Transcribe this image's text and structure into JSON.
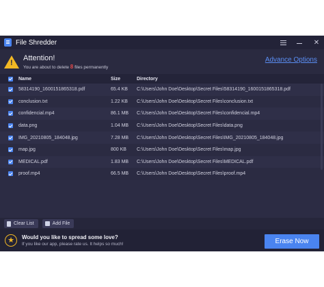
{
  "window": {
    "title": "File Shredder"
  },
  "attention": {
    "title": "Attention!",
    "message_prefix": "You are about to delete",
    "count": "8",
    "message_suffix": "files permanently",
    "advance_link": "Advance Options"
  },
  "table": {
    "headers": {
      "name": "Name",
      "size": "Size",
      "directory": "Directory"
    },
    "rows": [
      {
        "name": "58314190_1600151865318.pdf",
        "size": "65.4 KB",
        "directory": "C:\\Users\\John Doe\\Desktop\\Secret Files\\58314190_1600151865318.pdf"
      },
      {
        "name": "conclusion.txt",
        "size": "1.22 KB",
        "directory": "C:\\Users\\John Doe\\Desktop\\Secret Files\\conclusion.txt"
      },
      {
        "name": "confidencial.mp4",
        "size": "86.1 MB",
        "directory": "C:\\Users\\John Doe\\Desktop\\Secret Files\\confidencial.mp4"
      },
      {
        "name": "data.png",
        "size": "1.04 MB",
        "directory": "C:\\Users\\John Doe\\Desktop\\Secret Files\\data.png"
      },
      {
        "name": "IMG_20210805_184048.jpg",
        "size": "7.28 MB",
        "directory": "C:\\Users\\John Doe\\Desktop\\Secret Files\\IMG_20210805_184048.jpg"
      },
      {
        "name": "map.jpg",
        "size": "800 KB",
        "directory": "C:\\Users\\John Doe\\Desktop\\Secret Files\\map.jpg"
      },
      {
        "name": "MEDICAL.pdf",
        "size": "1.83 MB",
        "directory": "C:\\Users\\John Doe\\Desktop\\Secret Files\\MEDICAL.pdf"
      },
      {
        "name": "proof.mp4",
        "size": "66.5 MB",
        "directory": "C:\\Users\\John Doe\\Desktop\\Secret Files\\proof.mp4"
      }
    ]
  },
  "toolbar": {
    "clear_label": "Clear List",
    "add_label": "Add File"
  },
  "footer": {
    "title": "Would you like to spread some love?",
    "subtitle": "If you like our app, please rate us. It helps so much!",
    "erase_label": "Erase Now"
  },
  "colors": {
    "accent": "#4a84f0",
    "warning": "#f2b824",
    "count": "#e54a4a",
    "background": "#2c2c44"
  }
}
